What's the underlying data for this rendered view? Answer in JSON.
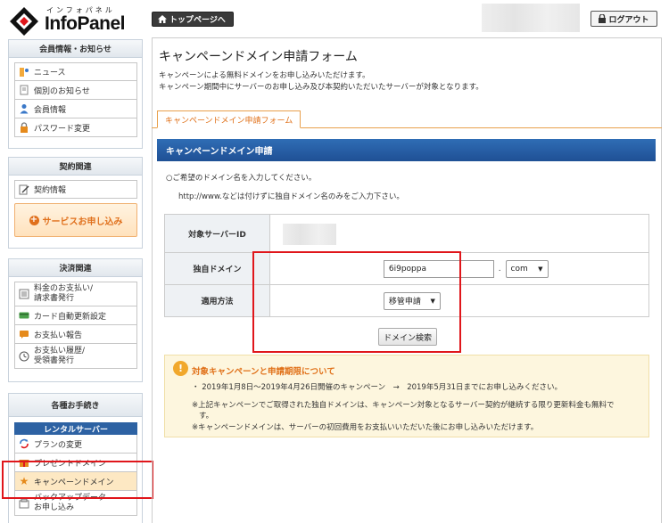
{
  "header": {
    "logo_kana": "インフォパネル",
    "logo_text": "InfoPanel",
    "top_page_button": "トップページへ",
    "logout_button": "ログアウト"
  },
  "sidebar": {
    "member": {
      "title": "会員情報・お知らせ",
      "items": [
        "ニュース",
        "個別のお知らせ",
        "会員情報",
        "パスワード変更"
      ]
    },
    "contract": {
      "title": "契約関連",
      "items": [
        "契約情報"
      ],
      "service_button": "サービスお申し込み"
    },
    "payment": {
      "title": "決済関連",
      "items": [
        {
          "line1": "料金のお支払い/",
          "line2": "請求書発行"
        },
        {
          "line1": "カード自動更新設定",
          "line2": ""
        },
        {
          "line1": "お支払い報告",
          "line2": ""
        },
        {
          "line1": "お支払い履歴/",
          "line2": "受領書発行"
        }
      ]
    },
    "procedures": {
      "title": "各種お手続き",
      "sub_title": "レンタルサーバー",
      "items": [
        {
          "line1": "プランの変更",
          "line2": ""
        },
        {
          "line1": "プレゼントドメイン",
          "line2": ""
        },
        {
          "line1": "キャンペーンドメイン",
          "line2": ""
        },
        {
          "line1": "バックアップデータ",
          "line2": "お申し込み"
        }
      ]
    }
  },
  "main": {
    "title": "キャンペーンドメイン申請フォーム",
    "desc_line1": "キャンペーンによる無料ドメインをお申し込みいただけます。",
    "desc_line2": "キャンペーン期間中にサーバーのお申し込み及び本契約いただいたサーバーが対象となります。",
    "tab": "キャンペーンドメイン申請フォーム",
    "section_title": "キャンペーンドメイン申請",
    "instruction1": "○ご希望のドメイン名を入力してください。",
    "instruction2": "http://www.などは付けずに独自ドメイン名のみをご入力下さい。",
    "form": {
      "server_id_label": "対象サーバーID",
      "domain_label": "独自ドメイン",
      "domain_value": "6i9poppa",
      "domain_dot": ".",
      "tld_value": "com",
      "method_label": "適用方法",
      "method_value": "移管申請",
      "search_button": "ドメイン検索"
    },
    "notice": {
      "title": "対象キャンペーンと申請期限について",
      "bullet": "・ 2019年1月8日～2019年4月26日開催のキャンペーン　→　2019年5月31日までにお申し込みください。",
      "note1": "※上記キャンペーンでご取得された独自ドメインは、キャンペーン対象となるサーバー契約が継続する限り更新料金も無料で",
      "note1b": "す。",
      "note2": "※キャンペーンドメインは、サーバーの初回費用をお支払いいただいた後にお申し込みいただけます。"
    }
  },
  "colors": {
    "accent_blue": "#2d62a3",
    "accent_orange": "#e07018",
    "highlight_red": "#e0161b"
  }
}
